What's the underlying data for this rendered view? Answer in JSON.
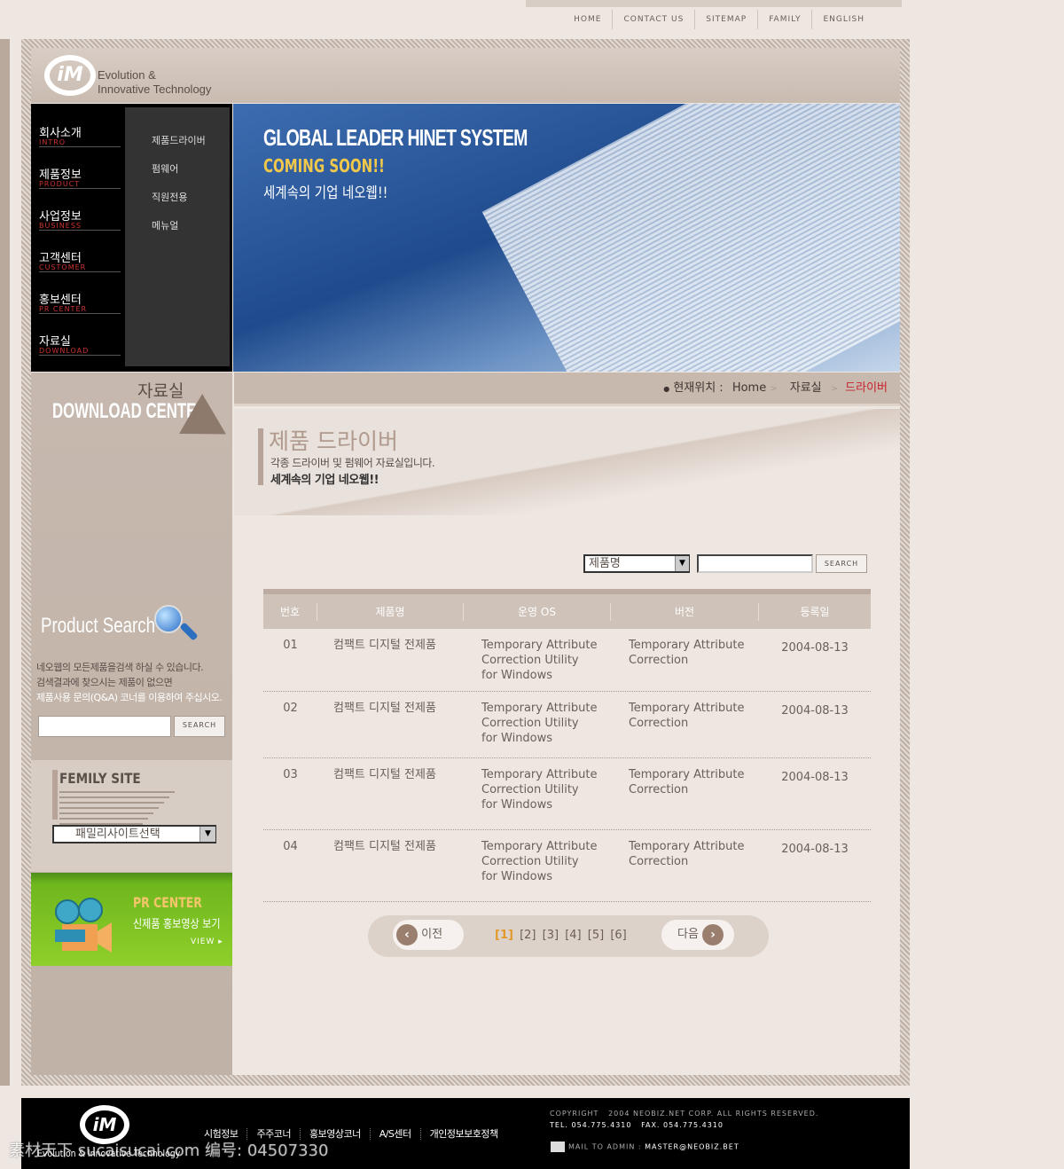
{
  "top_nav": [
    "HOME",
    "CONTACT US",
    "SITEMAP",
    "FAMILY",
    "ENGLISH"
  ],
  "logo": {
    "mark": "iM",
    "line1": "Evolution &",
    "line2": "Innovative Technology"
  },
  "nav": [
    {
      "ko": "회사소개",
      "en": "INTRO"
    },
    {
      "ko": "제품정보",
      "en": "PRODUCT"
    },
    {
      "ko": "사업정보",
      "en": "BUSINESS"
    },
    {
      "ko": "고객센터",
      "en": "CUSTOMER"
    },
    {
      "ko": "홍보센터",
      "en": "PR CENTER"
    },
    {
      "ko": "자료실",
      "en": "DOWNLOAD"
    }
  ],
  "subnav": [
    "제품드라이버",
    "펌웨어",
    "직원전용",
    "메뉴얼"
  ],
  "banner": {
    "title": "GLOBAL LEADER HINET SYSTEM",
    "subtitle": "COMING SOON!!",
    "tagline": "세계속의 기업 네오웹!!"
  },
  "side": {
    "section_ko": "자료실",
    "section_en": "DOWNLOAD CENTER",
    "product_search": {
      "title": "Product Search",
      "desc": [
        "네오웹의 모든제품을검색 하실 수 있습니다.",
        "검색결과에 찾으시는 제품이 없으면",
        "제품사용 문의(Q&A) 코너를 이용하여 주십시오."
      ],
      "input": "",
      "button": "SEARCH"
    },
    "family": {
      "title": "FEMILY SITE",
      "select": "패밀리사이트선택"
    },
    "pr": {
      "title": "PR CENTER",
      "sub": "신제품 홍보영상 보기",
      "view": "VIEW"
    }
  },
  "breadcrumb": {
    "label": "현재위치 :",
    "items": [
      "Home",
      "자료실"
    ],
    "current": "드라이버"
  },
  "page": {
    "title": "제품 드라이버",
    "desc": "각종 드라이버 및 펌웨어 자료실입니다.",
    "slogan": "세계속의 기업 네오웹!!"
  },
  "search": {
    "select": "제품명",
    "input": "",
    "button": "SEARCH"
  },
  "table": {
    "headers": [
      "번호",
      "제품명",
      "운영 OS",
      "버전",
      "등록일"
    ],
    "rows": [
      {
        "no": "01",
        "name": "컴팩트 디지털 전제품",
        "os": [
          "Temporary Attribute",
          "Correction Utility",
          "for Windows"
        ],
        "ver": [
          "Temporary Attribute",
          "Correction"
        ],
        "date": "2004-08-13"
      },
      {
        "no": "02",
        "name": "컴팩트 디지털 전제품",
        "os": [
          "Temporary Attribute",
          "Correction Utility",
          "for Windows"
        ],
        "ver": [
          "Temporary Attribute",
          "Correction"
        ],
        "date": "2004-08-13"
      },
      {
        "no": "03",
        "name": "컴팩트 디지털 전제품",
        "os": [
          "Temporary Attribute",
          "Correction Utility",
          "for Windows"
        ],
        "ver": [
          "Temporary Attribute",
          "Correction"
        ],
        "date": "2004-08-13"
      },
      {
        "no": "04",
        "name": "컴팩트 디지털 전제품",
        "os": [
          "Temporary Attribute",
          "Correction Utility",
          "for Windows"
        ],
        "ver": [
          "Temporary Attribute",
          "Correction"
        ],
        "date": "2004-08-13"
      }
    ]
  },
  "pager": {
    "prev": "이전",
    "next": "다음",
    "pages": [
      "[1]",
      "[2]",
      "[3]",
      "[4]",
      "[5]",
      "[6]"
    ],
    "current": "[1]"
  },
  "footer": {
    "links": [
      "시험정보",
      "주주코너",
      "홍보영상코너",
      "A/S센터",
      "개인정보보호정책"
    ],
    "copyright": "COPYRIGHT   2004 NEOBIZ.NET CORP. ALL RIGHTS RESERVED.",
    "tel": "TEL. 054.775.4310   FAX. 054.775.4310",
    "mail_label": "MAIL TO ADMIN :",
    "mail": "MASTER@NEOBIZ.BET",
    "logo_line": "Evolution & Innovative Technology"
  },
  "watermark": "素材天下 sucaisucai.com  编号: 04507330"
}
